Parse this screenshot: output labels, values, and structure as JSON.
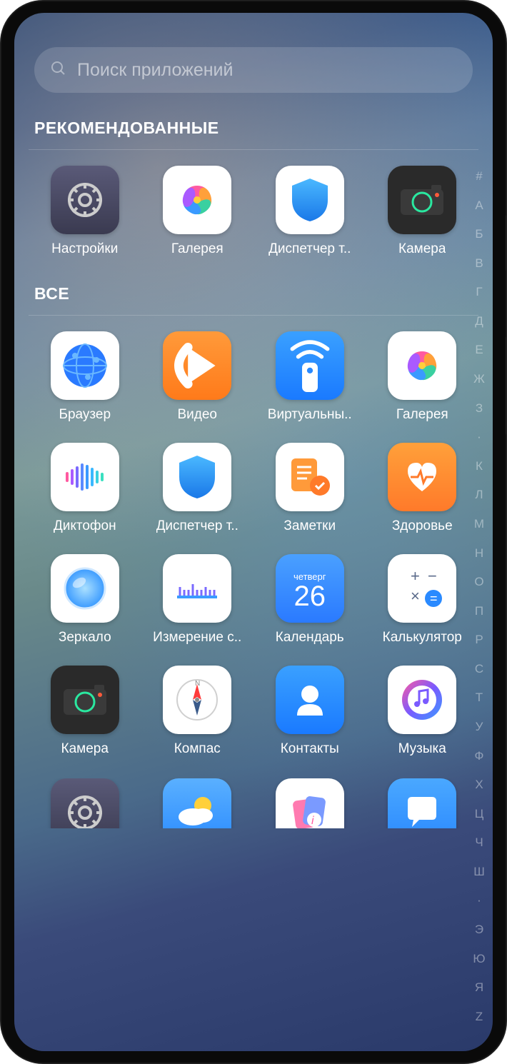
{
  "search": {
    "placeholder": "Поиск приложений"
  },
  "sections": {
    "recommended": "РЕКОМЕНДОВАННЫЕ",
    "all": "ВСЕ"
  },
  "recommended": [
    {
      "label": "Настройки",
      "icon": "settings"
    },
    {
      "label": "Галерея",
      "icon": "gallery"
    },
    {
      "label": "Диспетчер т..",
      "icon": "shield"
    },
    {
      "label": "Камера",
      "icon": "camera"
    }
  ],
  "all": [
    {
      "label": "Браузер",
      "icon": "browser"
    },
    {
      "label": "Видео",
      "icon": "video"
    },
    {
      "label": "Виртуальны..",
      "icon": "remote"
    },
    {
      "label": "Галерея",
      "icon": "gallery"
    },
    {
      "label": "Диктофон",
      "icon": "recorder"
    },
    {
      "label": "Диспетчер т..",
      "icon": "shield"
    },
    {
      "label": "Заметки",
      "icon": "notes"
    },
    {
      "label": "Здоровье",
      "icon": "health"
    },
    {
      "label": "Зеркало",
      "icon": "mirror"
    },
    {
      "label": "Измерение с..",
      "icon": "ruler"
    },
    {
      "label": "Календарь",
      "icon": "calendar"
    },
    {
      "label": "Калькулятор",
      "icon": "calculator"
    },
    {
      "label": "Камера",
      "icon": "camera"
    },
    {
      "label": "Компас",
      "icon": "compass"
    },
    {
      "label": "Контакты",
      "icon": "contacts"
    },
    {
      "label": "Музыка",
      "icon": "music"
    },
    {
      "label": "",
      "icon": "settings"
    },
    {
      "label": "",
      "icon": "weather"
    },
    {
      "label": "",
      "icon": "themes"
    },
    {
      "label": "",
      "icon": "messages"
    }
  ],
  "calendar": {
    "day_name": "четверг",
    "day_num": "26"
  },
  "alpha_index": [
    "#",
    "А",
    "Б",
    "В",
    "Г",
    "Д",
    "Е",
    "Ж",
    "З",
    "·",
    "К",
    "Л",
    "М",
    "Н",
    "О",
    "П",
    "Р",
    "С",
    "Т",
    "У",
    "Ф",
    "Х",
    "Ц",
    "Ч",
    "Ш",
    "·",
    "Э",
    "Ю",
    "Я",
    "Z"
  ]
}
